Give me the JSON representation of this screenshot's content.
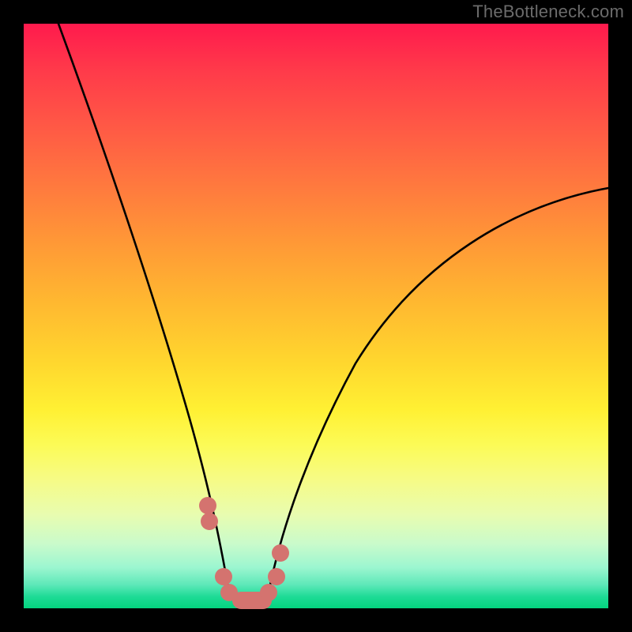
{
  "watermark": "TheBottleneck.com",
  "colors": {
    "frame": "#000000",
    "watermark": "#6b6b6b",
    "curve": "#000000",
    "bead": "#d4736f"
  },
  "chart_data": {
    "type": "line",
    "title": "",
    "xlabel": "",
    "ylabel": "",
    "xlim": [
      0,
      100
    ],
    "ylim": [
      0,
      100
    ],
    "series": [
      {
        "name": "left-curve",
        "x": [
          6,
          10,
          14,
          18,
          22,
          26,
          28,
          30,
          32,
          33.5,
          35.1
        ],
        "y": [
          100,
          88,
          76,
          64,
          52,
          39,
          31,
          22,
          14,
          8,
          2.7
        ]
      },
      {
        "name": "right-curve",
        "x": [
          41.9,
          44,
          47,
          52,
          58,
          66,
          76,
          88,
          100
        ],
        "y": [
          2.7,
          7,
          14,
          24,
          34,
          44,
          54,
          64,
          72
        ]
      }
    ],
    "annotations": {
      "bottom_beads_x": [
        31.5,
        31.8,
        34.2,
        35.1,
        37.2,
        39.9,
        41.9,
        43.2,
        43.9
      ],
      "bottom_beads_y": [
        17.6,
        14.9,
        5.4,
        2.7,
        1.4,
        1.4,
        2.7,
        5.4,
        9.5
      ]
    }
  }
}
